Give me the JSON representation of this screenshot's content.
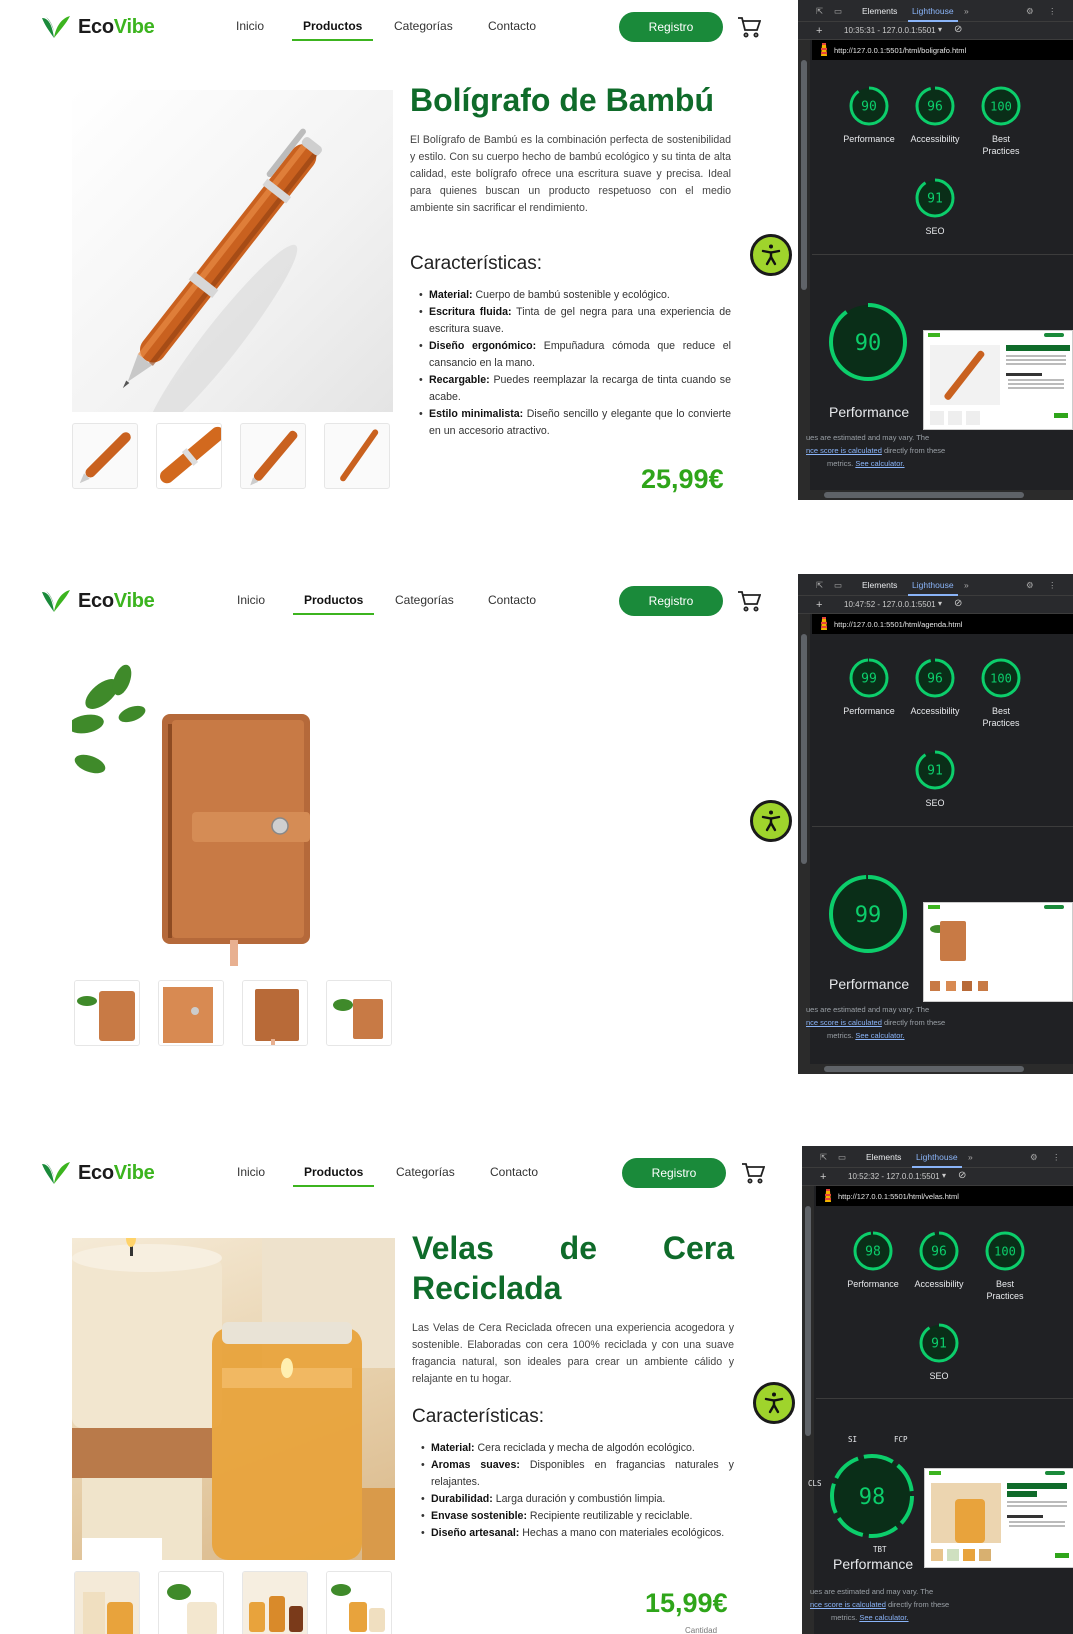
{
  "site": {
    "logo_eco": "Eco",
    "logo_vibe": "Vibe",
    "nav": [
      "Inicio",
      "Productos",
      "Categorías",
      "Contacto"
    ],
    "register_label": "Registro"
  },
  "panels": [
    {
      "product": {
        "title": "Bolígrafo de Bambú",
        "description": "El Bolígrafo de Bambú es la combinación perfecta de sostenibilidad y estilo. Con su cuerpo hecho de bambú ecológico y su tinta de alta calidad, este bolígrafo ofrece una escritura suave y precisa. Ideal para quienes buscan un producto respetuoso con el medio ambiente sin sacrificar el rendimiento.",
        "features_title": "Características:",
        "features": [
          {
            "label": "Material:",
            "text": " Cuerpo de bambú sostenible y ecológico."
          },
          {
            "label": "Escritura fluida:",
            "text": " Tinta de gel negra para una experiencia de escritura suave."
          },
          {
            "label": "Diseño ergonómico:",
            "text": " Empuñadura cómoda que reduce el cansancio en la mano."
          },
          {
            "label": "Recargable:",
            "text": " Puedes reemplazar la recarga de tinta cuando se acabe."
          },
          {
            "label": "Estilo minimalista:",
            "text": " Diseño sencillo y elegante que lo convierte en un accesorio atractivo."
          }
        ],
        "price": "25,99€"
      },
      "devtools": {
        "time": "10:35:31 - 127.0.0.1:5501",
        "url": "http://127.0.0.1:5501/html/boligrafo.html",
        "scores": {
          "performance": 90,
          "accessibility": 96,
          "best_practices": 100,
          "seo": 91
        }
      }
    },
    {
      "devtools": {
        "time": "10:47:52 - 127.0.0.1:5501",
        "url": "http://127.0.0.1:5501/html/agenda.html",
        "scores": {
          "performance": 99,
          "accessibility": 96,
          "best_practices": 100,
          "seo": 91
        }
      }
    },
    {
      "product": {
        "title_line1": "Velas de Cera",
        "title_line2": "Reciclada",
        "description": "Las Velas de Cera Reciclada ofrecen una experiencia acogedora y sostenible. Elaboradas con cera 100% reciclada y con una suave fragancia natural, son ideales para crear un ambiente cálido y relajante en tu hogar.",
        "features_title": "Características:",
        "features": [
          {
            "label": "Material:",
            "text": " Cera reciclada y mecha de algodón ecológico."
          },
          {
            "label": "Aromas suaves:",
            "text": " Disponibles en fragancias naturales y relajantes."
          },
          {
            "label": "Durabilidad:",
            "text": " Larga duración y combustión limpia."
          },
          {
            "label": "Envase sostenible:",
            "text": " Recipiente reutilizable y reciclable."
          },
          {
            "label": "Diseño artesanal:",
            "text": " Hechas a mano con materiales ecológicos."
          }
        ],
        "price": "15,99€",
        "quantity_label": "Cantidad"
      },
      "devtools": {
        "time": "10:52:32 - 127.0.0.1:5501",
        "url": "http://127.0.0.1:5501/html/velas.html",
        "scores": {
          "performance": 98,
          "accessibility": 96,
          "best_practices": 100,
          "seo": 91
        },
        "metric_labels": [
          "SI",
          "FCP",
          "CLS",
          "TBT"
        ]
      }
    }
  ],
  "devtools_common": {
    "tab_elements": "Elements",
    "tab_lighthouse": "Lighthouse",
    "label_performance": "Performance",
    "label_accessibility": "Accessibility",
    "label_best": "Best",
    "label_practices": "Practices",
    "label_seo": "SEO",
    "note_line1": "ues are estimated and may vary. The",
    "note_link1": "nce score is calculated",
    "note_line2": " directly from these",
    "note_line3": "metrics. ",
    "note_link2": "See calculator."
  },
  "colors": {
    "brand_green": "#3cb41f",
    "title_green": "#0f6b2a",
    "button_green": "#1a8a3a",
    "score_green": "#0cce6b",
    "devtools_bg": "#202124",
    "a11y_button": "#9fd42c"
  }
}
